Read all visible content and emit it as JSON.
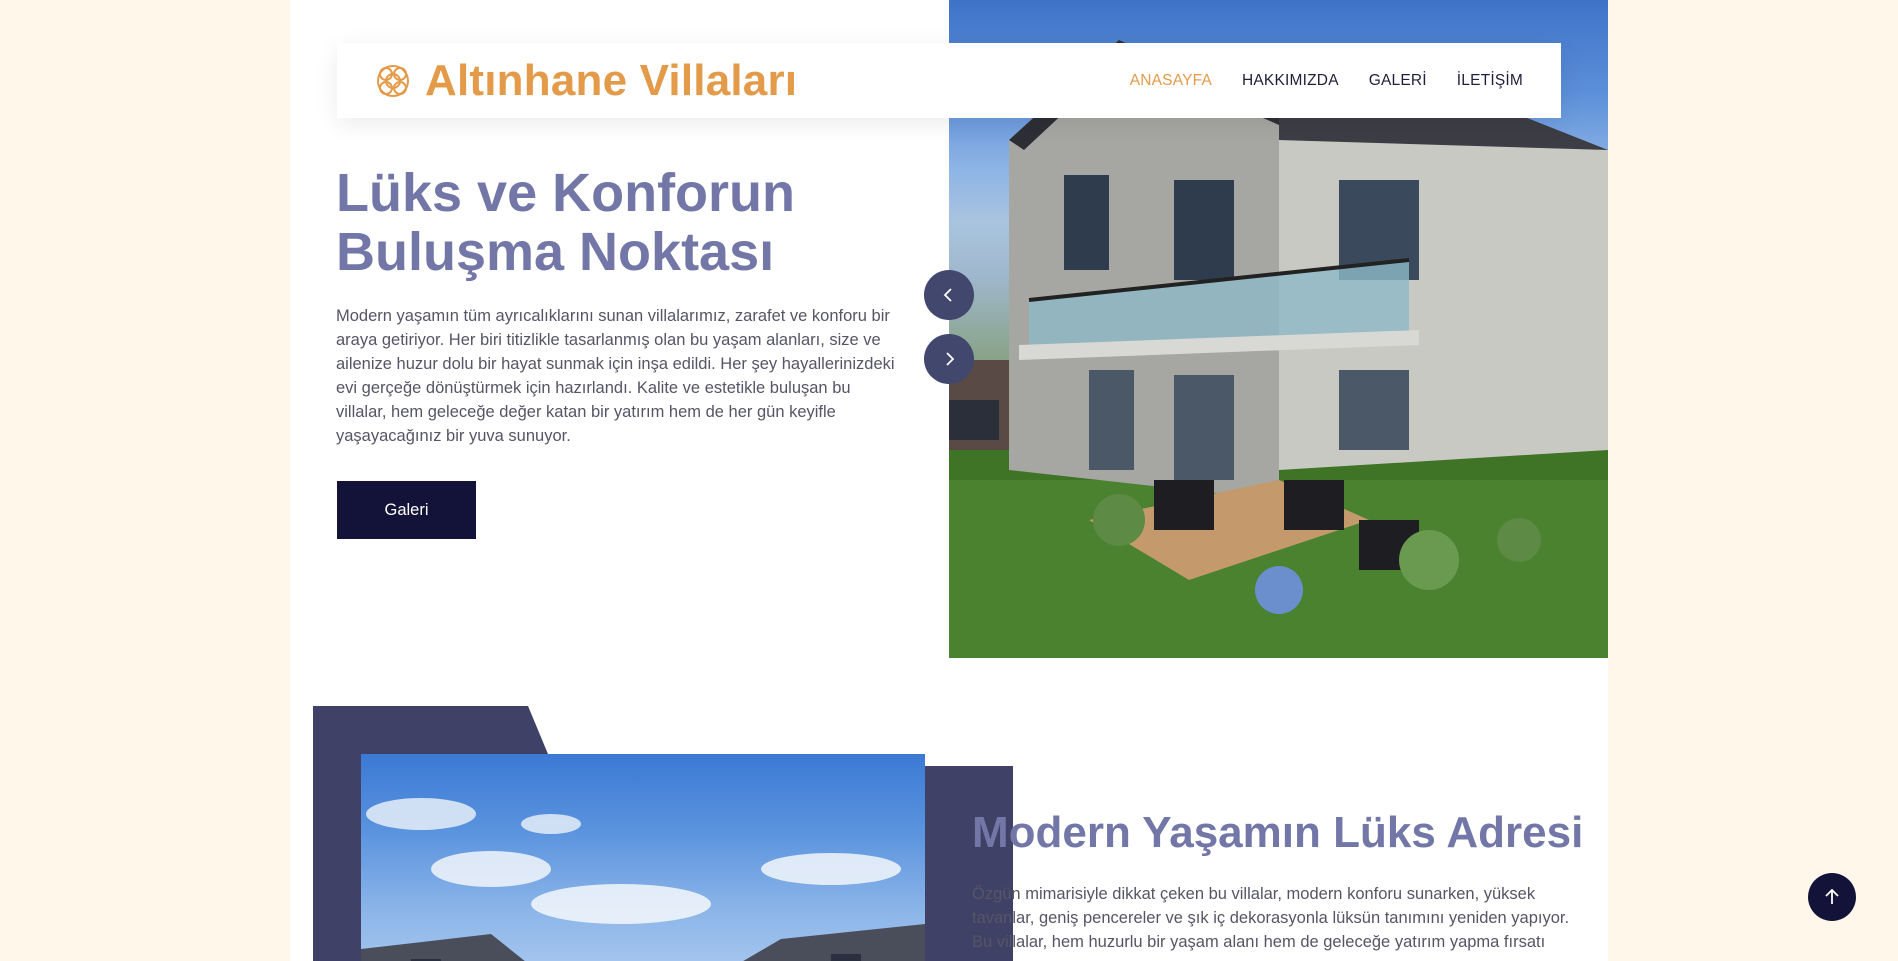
{
  "brand": {
    "name": "Altınhane Villaları",
    "icon": "ornament-knot-icon"
  },
  "nav": {
    "items": [
      {
        "label": "ANASAYFA",
        "active": true
      },
      {
        "label": "HAKKIMIZDA",
        "active": false
      },
      {
        "label": "GALERİ",
        "active": false
      },
      {
        "label": "İLETİŞİM",
        "active": false
      }
    ]
  },
  "hero": {
    "title": "Lüks ve Konforun Buluşma Noktası",
    "text": "Modern yaşamın tüm ayrıcalıklarını sunan villalarımız, zarafet ve konforu bir araya getiriyor. Her biri titizlikle tasarlanmış olan bu yaşam alanları, size ve ailenize huzur dolu bir hayat sunmak için inşa edildi. Her şey hayallerinizdeki evi gerçeğe dönüştürmek için hazırlandı. Kalite ve estetikle buluşan bu villalar, hem geleceğe değer katan bir yatırım hem de her gün keyifle yaşayacağınız bir yuva sunuyor.",
    "button_label": "Galeri",
    "prev_icon": "chevron-left-icon",
    "next_icon": "chevron-right-icon"
  },
  "section2": {
    "title": "Modern Yaşamın Lüks Adresi",
    "text": "Özgün mimarisiyle dikkat çeken bu villalar, modern konforu sunarken, yüksek tavanlar, geniş pencereler ve şık iç dekorasyonla lüksün tanımını yeniden yapıyor. Bu villalar, hem huzurlu bir yaşam alanı hem de geleceğe yatırım yapma fırsatı sunuyor."
  },
  "scroll_top": {
    "icon": "arrow-up-icon"
  },
  "colors": {
    "accent": "#e39b4a",
    "heading": "#7277a8",
    "dark": "#13133a",
    "background": "#fff8ea"
  }
}
